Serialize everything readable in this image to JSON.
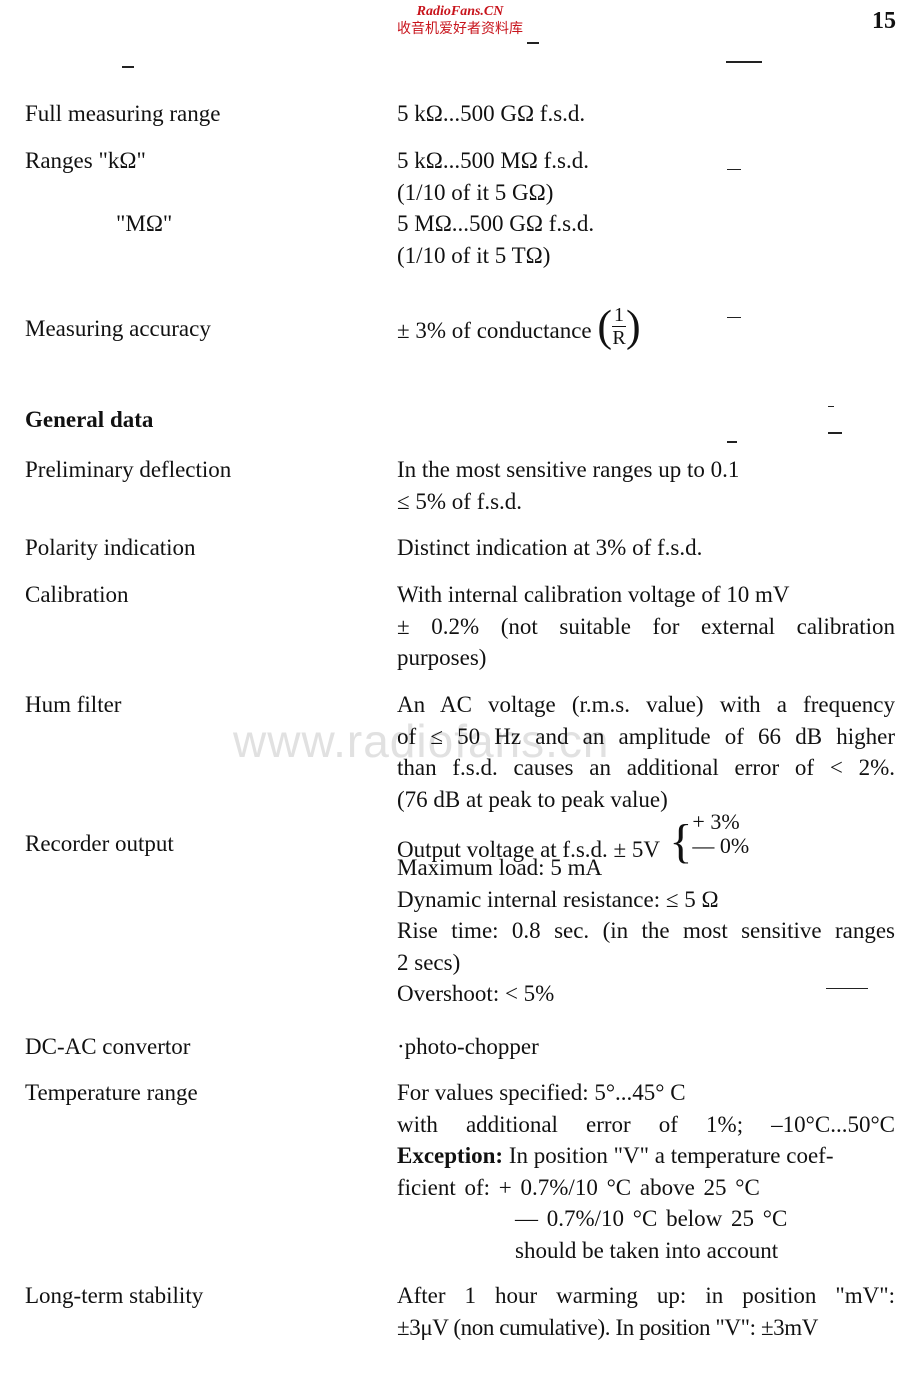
{
  "header": {
    "brand_en": "RadioFans.CN",
    "brand_cn": "收音机爱好者资料库",
    "page_number": "15"
  },
  "watermark": "www.radiofans.cn",
  "specs_top": [
    {
      "label": "Full measuring range",
      "lines": [
        "5 kΩ...500 GΩ f.s.d."
      ]
    },
    {
      "label": "Ranges  \"kΩ\"",
      "lines": [
        "5 kΩ...500 MΩ f.s.d.",
        "(1/10 of it 5 GΩ)"
      ]
    },
    {
      "label": "\"MΩ\"",
      "lines": [
        "5 MΩ...500 GΩ f.s.d.",
        "(1/10 of it 5 TΩ)"
      ]
    }
  ],
  "accuracy": {
    "label": "Measuring accuracy",
    "text": "± 3% of conductance",
    "fraction_numerator": "1",
    "fraction_denominator": "R"
  },
  "general_section_title": "General data",
  "general": {
    "preliminary": {
      "label": "Preliminary deflection",
      "lines": [
        "In the most sensitive ranges up to 0.1",
        "≤ 5% of f.s.d."
      ]
    },
    "polarity": {
      "label": "Polarity indication",
      "lines": [
        "Distinct indication at 3% of f.s.d."
      ]
    },
    "calibration": {
      "label": "Calibration",
      "lines": [
        "With internal calibration voltage of 10 mV",
        "± 0.2% (not suitable for external calibration",
        "purposes)"
      ]
    },
    "hum": {
      "label": "Hum filter",
      "lines": [
        "An AC voltage (r.m.s. value) with a frequency",
        "of ≤ 50 Hz and an amplitude of 66 dB higher",
        "than f.s.d. causes an additional error of < 2%.",
        "(76 dB at peak to peak value)"
      ]
    },
    "recorder": {
      "label": "Recorder output",
      "output_voltage": "Output voltage at f.s.d. ± 5V",
      "tolerance_plus": "+ 3%",
      "tolerance_minus": "— 0%",
      "lines": [
        "Maximum load: 5 mA",
        "Dynamic internal resistance: ≤ 5 Ω",
        "Rise time: 0.8 sec. (in the most sensitive ranges",
        "2 secs)",
        "Overshoot: < 5%"
      ]
    },
    "convertor": {
      "label": "DC-AC convertor",
      "lines": [
        "·photo-chopper"
      ]
    },
    "temperature": {
      "label": "Temperature range",
      "lines": [
        "For values specified: 5°...45° C",
        "with additional error of 1%; –10°C...50°C"
      ],
      "exception_keyword": "Exception:",
      "exception_text": " In position \"V\" a temperature coef-",
      "coef_line1": "ficient of:  + 0.7%/10 °C above 25 °C",
      "coef_line2": "— 0.7%/10 °C below 25 °C",
      "coef_line3": "should be taken into account"
    },
    "stability": {
      "label": "Long-term stability",
      "lines": [
        "After 1 hour warming up: in position \"mV\":",
        "±3μV (non cumulative). In position \"V\": ±3mV"
      ]
    }
  }
}
